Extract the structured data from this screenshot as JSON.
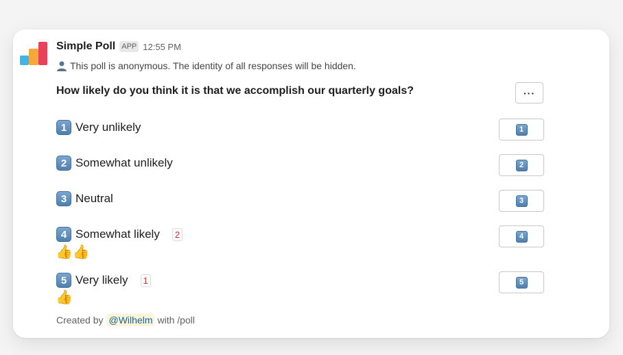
{
  "app": {
    "name": "Simple Poll",
    "badge": "APP",
    "timestamp": "12:55 PM"
  },
  "notice": {
    "icon": "person-icon",
    "text": "This poll is anonymous. The identity of all responses will be hidden."
  },
  "poll": {
    "question": "How likely do you think it is that we accomplish our quarterly goals?",
    "more_label": "···",
    "options": [
      {
        "key": "1",
        "label": "Very unlikely",
        "count": null,
        "votes": ""
      },
      {
        "key": "2",
        "label": "Somewhat unlikely",
        "count": null,
        "votes": ""
      },
      {
        "key": "3",
        "label": "Neutral",
        "count": null,
        "votes": ""
      },
      {
        "key": "4",
        "label": "Somewhat likely",
        "count": "2",
        "votes": "👍👍"
      },
      {
        "key": "5",
        "label": "Very likely",
        "count": "1",
        "votes": "👍"
      }
    ]
  },
  "footer": {
    "prefix": "Created by",
    "mention": "@Wilhelm",
    "suffix": "with /poll"
  },
  "colors": {
    "logo_red": "#e8415a",
    "logo_orange": "#f4a83a",
    "logo_blue": "#3fb5e8",
    "mention": "#1264a3"
  }
}
